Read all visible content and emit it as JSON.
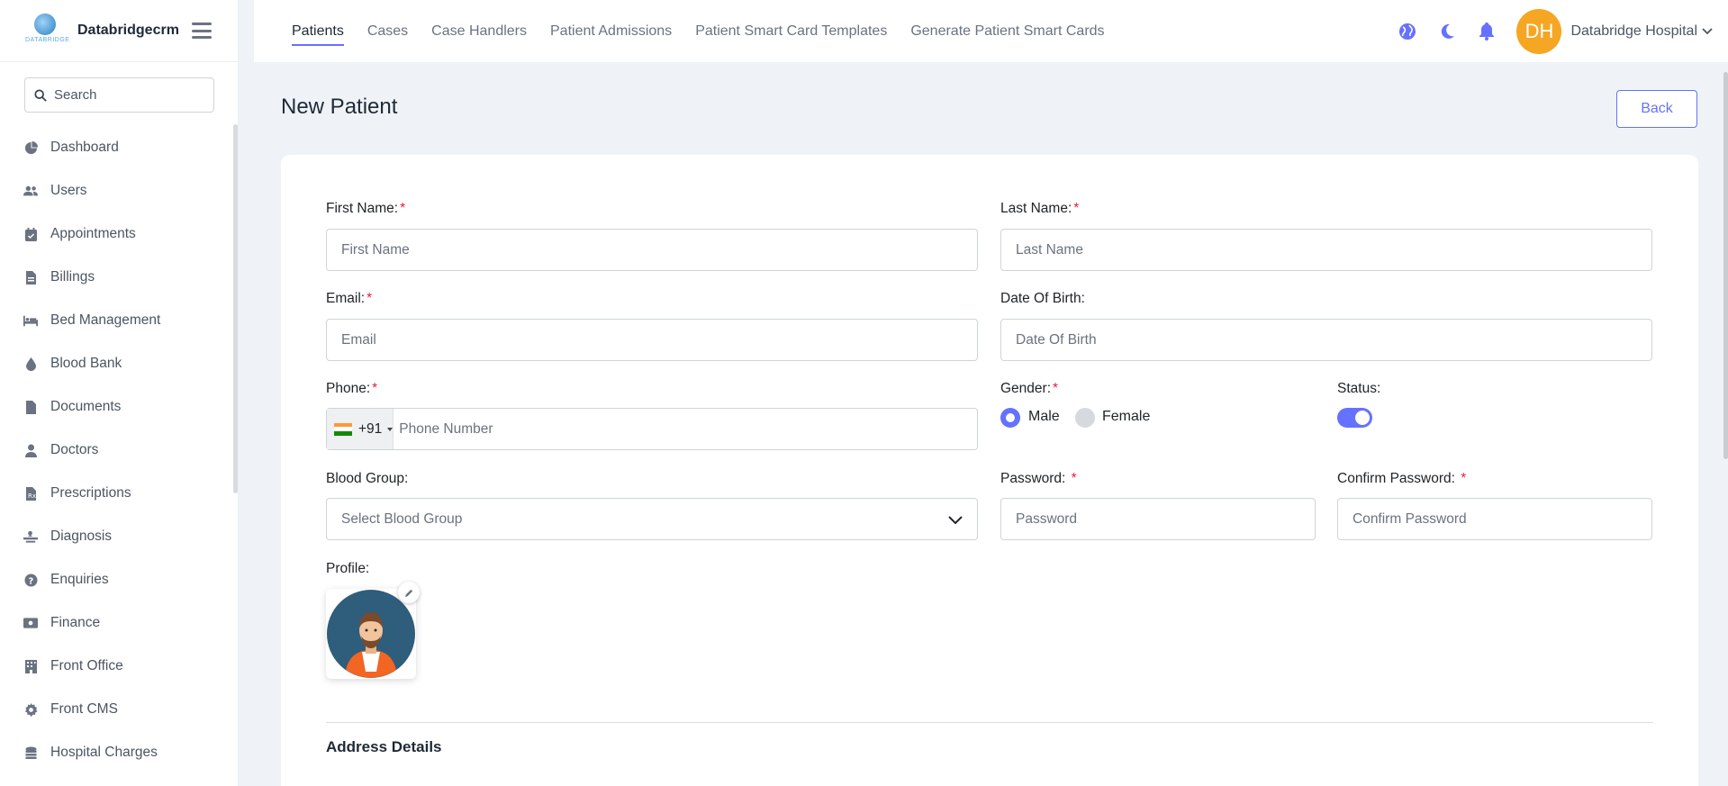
{
  "brand": {
    "name": "Databridgecrm",
    "logo_tag": "DATABRIDGE"
  },
  "sidebar": {
    "search_placeholder": "Search",
    "items": [
      {
        "label": "Dashboard",
        "icon": "pie-chart-icon"
      },
      {
        "label": "Users",
        "icon": "users-icon"
      },
      {
        "label": "Appointments",
        "icon": "calendar-check-icon"
      },
      {
        "label": "Billings",
        "icon": "file-invoice-icon"
      },
      {
        "label": "Bed Management",
        "icon": "bed-icon"
      },
      {
        "label": "Blood Bank",
        "icon": "droplet-icon"
      },
      {
        "label": "Documents",
        "icon": "document-icon"
      },
      {
        "label": "Doctors",
        "icon": "doctor-icon"
      },
      {
        "label": "Prescriptions",
        "icon": "prescription-icon"
      },
      {
        "label": "Diagnosis",
        "icon": "diagnosis-icon"
      },
      {
        "label": "Enquiries",
        "icon": "question-circle-icon"
      },
      {
        "label": "Finance",
        "icon": "money-bill-icon"
      },
      {
        "label": "Front Office",
        "icon": "building-icon"
      },
      {
        "label": "Front CMS",
        "icon": "gear-icon"
      },
      {
        "label": "Hospital Charges",
        "icon": "coins-icon"
      }
    ]
  },
  "topnav": {
    "tabs": [
      "Patients",
      "Cases",
      "Case Handlers",
      "Patient Admissions",
      "Patient Smart Card Templates",
      "Generate Patient Smart Cards"
    ],
    "active_tab": "Patients",
    "user_initials": "DH",
    "user_name": "Databridge Hospital"
  },
  "page": {
    "title": "New Patient",
    "back_label": "Back"
  },
  "form": {
    "first_name": {
      "label": "First Name:",
      "placeholder": "First Name"
    },
    "last_name": {
      "label": "Last Name:",
      "placeholder": "Last Name"
    },
    "email": {
      "label": "Email:",
      "placeholder": "Email"
    },
    "dob": {
      "label": "Date Of Birth:",
      "placeholder": "Date Of Birth"
    },
    "phone": {
      "label": "Phone:",
      "dial_code": "+91",
      "placeholder": "Phone Number"
    },
    "gender": {
      "label": "Gender:",
      "options": [
        "Male",
        "Female"
      ],
      "selected": "Male"
    },
    "status": {
      "label": "Status:",
      "enabled": true
    },
    "blood_group": {
      "label": "Blood Group:",
      "placeholder": "Select Blood Group"
    },
    "password": {
      "label": "Password:",
      "placeholder": "Password"
    },
    "confirm_password": {
      "label": "Confirm Password:",
      "placeholder": "Confirm Password"
    },
    "profile": {
      "label": "Profile:"
    },
    "address_section": "Address Details"
  },
  "colors": {
    "accent": "#6571ff",
    "avatar": "#f5a623",
    "required": "#e11d48"
  }
}
